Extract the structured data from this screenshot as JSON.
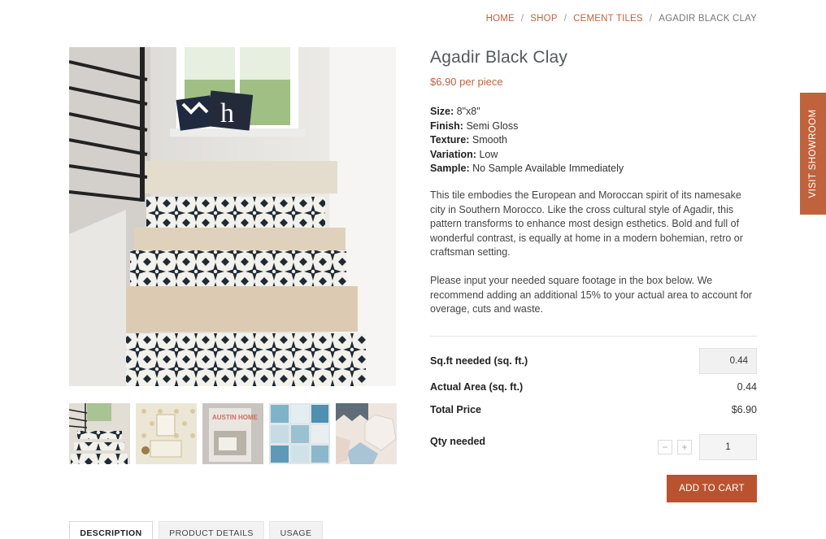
{
  "breadcrumb": {
    "items": [
      "HOME",
      "SHOP",
      "CEMENT TILES"
    ],
    "current": "AGADIR BLACK CLAY",
    "separator": "/"
  },
  "product": {
    "title": "Agadir Black Clay",
    "price": "$6.90 per piece",
    "specs": [
      {
        "label": "Size:",
        "value": "8\"x8\""
      },
      {
        "label": "Finish:",
        "value": "Semi Gloss"
      },
      {
        "label": "Texture:",
        "value": "Smooth"
      },
      {
        "label": "Variation:",
        "value": "Low"
      },
      {
        "label": "Sample:",
        "value": "No Sample Available Immediately"
      }
    ],
    "description": "This tile embodies the European and Moroccan spirit of its namesake city in Southern Morocco. Like the cross cultural style of Agadir, this pattern transforms to enhance most design esthetics. Bold and full of wonderful contrast, is equally at home in a modern bohemian, retro or craftsman setting.",
    "note": "Please input your needed square footage in the box below. We recommend adding an additional 15% to your actual area to account for overage, cuts and waste."
  },
  "calculator": {
    "sqft_label": "Sq.ft needed (sq. ft.)",
    "sqft_value": "0.44",
    "actual_label": "Actual Area (sq. ft.)",
    "actual_value": "0.44",
    "total_label": "Total Price",
    "total_value": "$6.90",
    "qty_label": "Qty needed",
    "qty_value": "1",
    "minus": "−",
    "plus": "+"
  },
  "add_to_cart": "ADD TO CART",
  "visit_showroom": "VISIT SHOWROOM",
  "tabs": [
    "DESCRIPTION",
    "PRODUCT DETAILS",
    "USAGE"
  ],
  "thumbnail_logo": "AUSTIN HOME",
  "colors": {
    "accent": "#c0623c",
    "button": "#b9532f"
  }
}
